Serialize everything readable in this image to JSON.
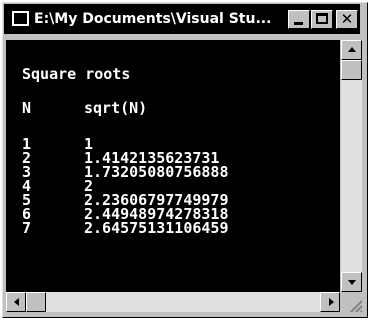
{
  "window": {
    "title": "E:\\My Documents\\Visual Stu...",
    "buttons": {
      "minimize": "minimize",
      "maximize": "maximize",
      "close": "✕"
    }
  },
  "console": {
    "heading": "Square roots",
    "columns": {
      "n": "N",
      "value": "sqrt(N)"
    },
    "rows": [
      {
        "n": "1",
        "value": "1"
      },
      {
        "n": "2",
        "value": "1.4142135623731"
      },
      {
        "n": "3",
        "value": "1.73205080756888"
      },
      {
        "n": "4",
        "value": "2"
      },
      {
        "n": "5",
        "value": "2.23606797749979"
      },
      {
        "n": "6",
        "value": "2.44948974278318"
      },
      {
        "n": "7",
        "value": "2.64575131106459"
      }
    ]
  },
  "colors": {
    "titlebar": "#000000",
    "console_bg": "#000000",
    "console_text": "#ffffff",
    "chrome": "#c0c0c0"
  }
}
